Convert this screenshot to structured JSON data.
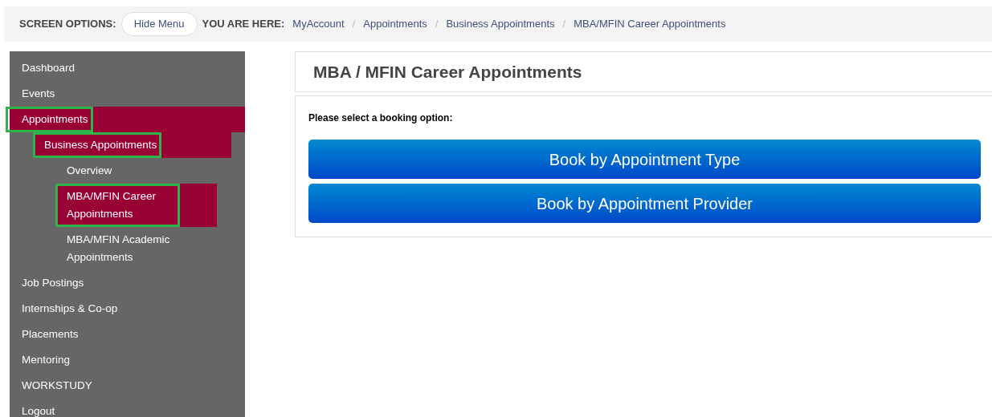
{
  "top_bar": {
    "screen_options_label": "SCREEN OPTIONS:",
    "hide_menu_button": "Hide Menu",
    "breadcrumb_label": "YOU ARE HERE:",
    "separator": "/",
    "breadcrumbs": [
      "MyAccount",
      "Appointments",
      "Business Appointments",
      "MBA/MFIN Career Appointments"
    ]
  },
  "sidebar": {
    "items": [
      {
        "label": "Dashboard",
        "selected": false,
        "highlighted": false
      },
      {
        "label": "Events",
        "selected": false,
        "highlighted": false
      },
      {
        "label": "Appointments",
        "selected": true,
        "highlighted": true,
        "children": [
          {
            "label": "Business Appointments",
            "selected": true,
            "highlighted": true,
            "children": [
              {
                "label": "Overview",
                "selected": false,
                "highlighted": false
              },
              {
                "label": "MBA/MFIN Career Appointments",
                "selected": true,
                "highlighted": true
              },
              {
                "label": "MBA/MFIN Academic Appointments",
                "selected": false,
                "highlighted": false
              }
            ]
          }
        ]
      },
      {
        "label": "Job Postings",
        "selected": false,
        "highlighted": false
      },
      {
        "label": "Internships & Co-op",
        "selected": false,
        "highlighted": false
      },
      {
        "label": "Placements",
        "selected": false,
        "highlighted": false
      },
      {
        "label": "Mentoring",
        "selected": false,
        "highlighted": false
      },
      {
        "label": "WORKSTUDY",
        "selected": false,
        "highlighted": false
      },
      {
        "label": "Logout",
        "selected": false,
        "highlighted": false
      }
    ]
  },
  "main": {
    "title": "MBA / MFIN Career Appointments",
    "prompt": "Please select a booking option:",
    "buttons": [
      "Book by Appointment Type",
      "Book by Appointment Provider"
    ]
  }
}
